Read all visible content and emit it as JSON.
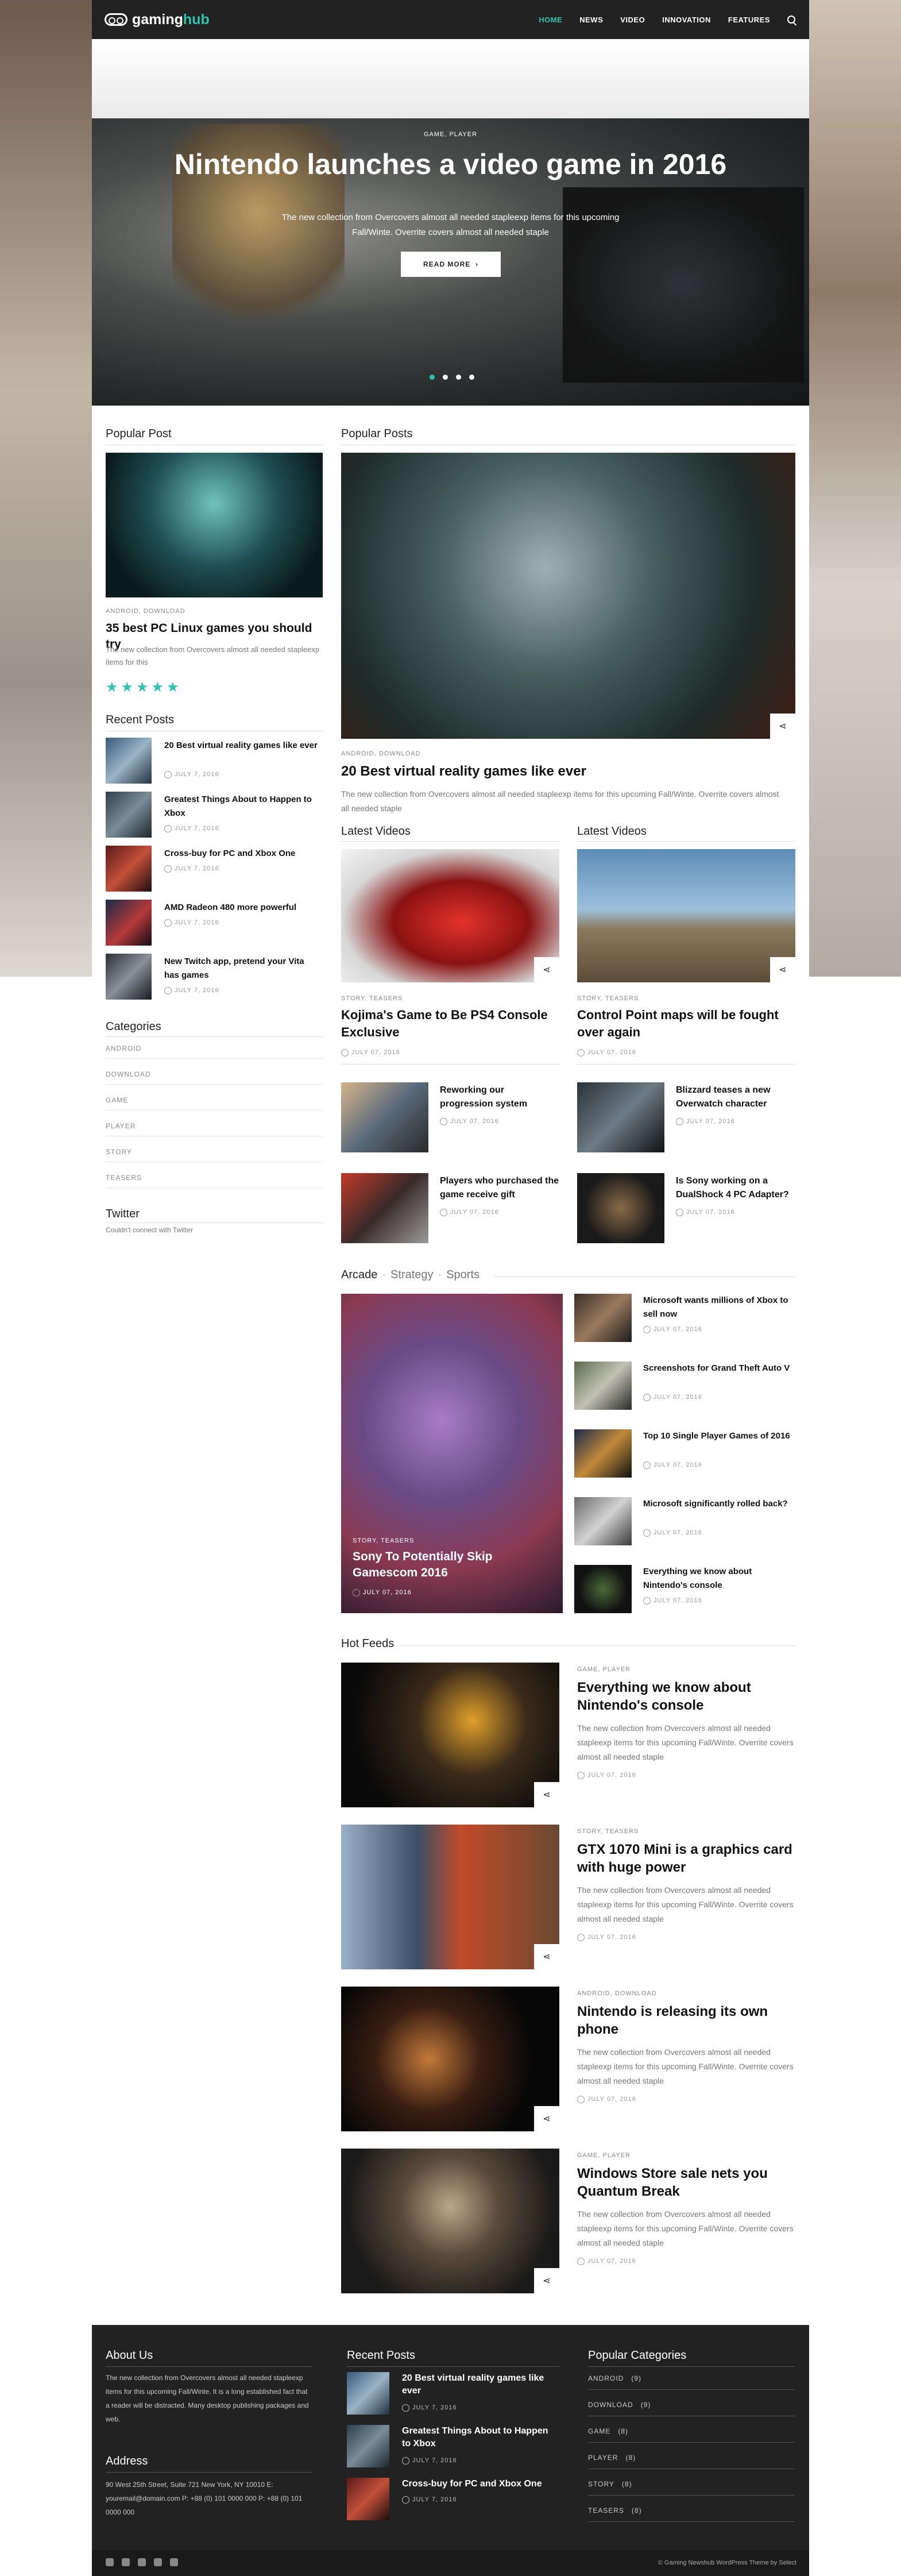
{
  "header": {
    "logo_gaming": "gaming",
    "logo_hub": "hub",
    "nav": [
      "HOME",
      "NEWS",
      "VIDEO",
      "INNOVATION",
      "FEATURES"
    ],
    "active_nav": "HOME"
  },
  "hero": {
    "category": "GAME, PLAYER",
    "title": "Nintendo launches a video game in 2016",
    "description": "The new collection from Overcovers almost all needed stapleexp items for this upcoming Fall/Winte. Overrite covers almost all needed staple",
    "button": "READ MORE",
    "slides": 4,
    "active_slide": 1
  },
  "sidebar": {
    "popular_heading": "Popular Post",
    "popular": {
      "category": "ANDROID, DOWNLOAD",
      "title": "35 best PC Linux games you should try",
      "description": "The new collection from Overcovers almost all needed stapleexp items for this",
      "rating": 5
    },
    "recent_heading": "Recent Posts",
    "recent": [
      {
        "title": "20 Best virtual reality games like ever",
        "date": "JULY 7, 2016"
      },
      {
        "title": "Greatest Things About to Happen to Xbox",
        "date": "JULY 7, 2016"
      },
      {
        "title": "Cross-buy for PC and Xbox One",
        "date": "JULY 7, 2016"
      },
      {
        "title": "AMD Radeon 480 more powerful",
        "date": "JULY 7, 2016"
      },
      {
        "title": "New Twitch app, pretend your Vita has games",
        "date": "JULY 7, 2016"
      }
    ],
    "categories_heading": "Categories",
    "categories": [
      "ANDROID",
      "DOWNLOAD",
      "GAME",
      "PLAYER",
      "STORY",
      "TEASERS"
    ],
    "twitter_heading": "Twitter",
    "twitter_text": "Couldn't connect with Twitter"
  },
  "main": {
    "popular_heading": "Popular Posts",
    "popular": {
      "category": "ANDROID, DOWNLOAD",
      "title": "20 Best virtual reality games like ever",
      "description": "The new collection from Overcovers almost all needed stapleexp items for this upcoming Fall/Winte. Overrite covers almost all needed staple"
    },
    "videos_left": {
      "heading": "Latest Videos",
      "category": "STORY, TEASERS",
      "title": "Kojima's Game to Be PS4 Console Exclusive",
      "date": "JULY 07, 2016",
      "items": [
        {
          "title": "Reworking our progression system",
          "date": "JULY 07, 2016"
        },
        {
          "title": "Players who purchased the game receive gift",
          "date": "JULY 07, 2016"
        }
      ]
    },
    "videos_right": {
      "heading": "Latest Videos",
      "category": "STORY, TEASERS",
      "title": "Control Point maps will be fought over again",
      "date": "JULY 07, 2016",
      "items": [
        {
          "title": "Blizzard teases a new Overwatch character",
          "date": "JULY 07, 2016"
        },
        {
          "title": "Is Sony working on a DualShock 4 PC Adapter?",
          "date": "JULY 07, 2016"
        }
      ]
    },
    "tabs": [
      "Arcade",
      "Strategy",
      "Sports"
    ],
    "featured": {
      "category": "STORY, TEASERS",
      "title": "Sony To Potentially Skip Gamescom 2016",
      "date": "JULY 07, 2016"
    },
    "tab_list": [
      {
        "title": "Microsoft wants millions of Xbox to sell now",
        "date": "JULY 07, 2016"
      },
      {
        "title": "Screenshots for Grand Theft Auto V",
        "date": "JULY 07, 2016"
      },
      {
        "title": "Top 10 Single Player Games of 2016",
        "date": "JULY 07, 2016"
      },
      {
        "title": "Microsoft significantly rolled back?",
        "date": "JULY 07, 2016"
      },
      {
        "title": "Everything we know about Nintendo's console",
        "date": "JULY 07, 2016"
      }
    ],
    "hot_heading": "Hot Feeds",
    "hot": [
      {
        "category": "GAME, PLAYER",
        "title": "Everything we know about Nintendo's console",
        "description": "The new collection from Overcovers almost all needed stapleexp items for this upcoming Fall/Winte. Overrite covers almost all needed staple",
        "date": "JULY 07, 2016"
      },
      {
        "category": "STORY, TEASERS",
        "title": "GTX 1070 Mini is a graphics card with huge power",
        "description": "The new collection from Overcovers almost all needed stapleexp items for this upcoming Fall/Winte. Overrite covers almost all needed staple",
        "date": "JULY 07, 2016"
      },
      {
        "category": "ANDROID, DOWNLOAD",
        "title": "Nintendo is releasing its own phone",
        "description": "The new collection from Overcovers almost all needed stapleexp items for this upcoming Fall/Winte. Overrite covers almost all needed staple",
        "date": "JULY 07, 2016"
      },
      {
        "category": "GAME, PLAYER",
        "title": "Windows Store sale nets you Quantum Break",
        "description": "The new collection from Overcovers almost all needed stapleexp items for this upcoming Fall/Winte. Overrite covers almost all needed staple",
        "date": "JULY 07, 2016"
      }
    ]
  },
  "footer": {
    "about_heading": "About Us",
    "about_text": "The new collection from Overcovers almost all needed stapleexp items for this upcoming Fall/Winte. It is a long established fact that a reader will be distracted. Many desktop publishing packages and web.",
    "address_heading": "Address",
    "address_text": "90 West 25th Street, Suite 721 New York, NY 10010 E: youremail@domain.com P: +88 (0) 101 0000 000 P: +88 (0) 101 0000 000",
    "recent_heading": "Recent Posts",
    "recent": [
      {
        "title": "20 Best virtual reality games like ever",
        "date": "JULY 7, 2016"
      },
      {
        "title": "Greatest Things About to Happen to Xbox",
        "date": "JULY 7, 2016"
      },
      {
        "title": "Cross-buy for PC and Xbox One",
        "date": "JULY 7, 2016"
      }
    ],
    "categories_heading": "Popular Categories",
    "categories": [
      {
        "name": "ANDROID",
        "count": "(9)"
      },
      {
        "name": "DOWNLOAD",
        "count": "(9)"
      },
      {
        "name": "GAME",
        "count": "(8)"
      },
      {
        "name": "PLAYER",
        "count": "(8)"
      },
      {
        "name": "STORY",
        "count": "(8)"
      },
      {
        "name": "TEASERS",
        "count": "(8)"
      }
    ],
    "copyright": "© Gaming Newshub WordPress Theme by Select"
  },
  "colors": {
    "accent": "#2cc4b0",
    "dark": "#222222"
  }
}
